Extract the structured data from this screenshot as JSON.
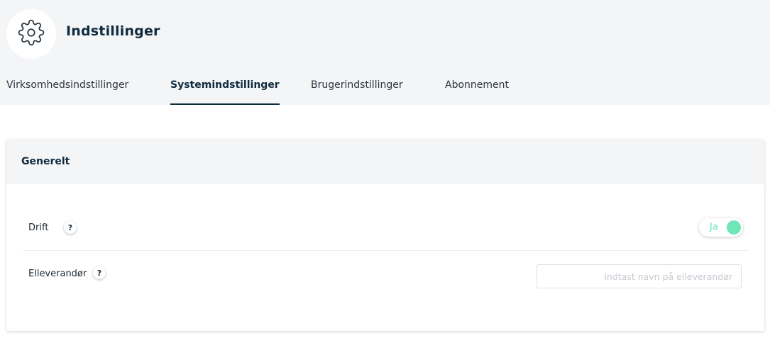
{
  "header": {
    "icon": "gear-icon",
    "title": "Indstillinger"
  },
  "tabs": [
    {
      "label": "Virksomhedsindstillinger",
      "active": false
    },
    {
      "label": "Systemindstillinger",
      "active": true
    },
    {
      "label": "Brugerindstillinger",
      "active": false
    },
    {
      "label": "Abonnement",
      "active": false
    }
  ],
  "section": {
    "title": "Generelt",
    "drift": {
      "label": "Drift",
      "help": "?",
      "toggle_label": "Ja",
      "toggle_on": true
    },
    "elleverandor": {
      "label": "Elleverandør",
      "help": "?",
      "value": "",
      "placeholder": "Indtast navn på elleverandør"
    }
  },
  "colors": {
    "accent": "#6ee6b8",
    "brand_dark": "#0f2b3f",
    "header_bg": "#f4f5f7"
  }
}
